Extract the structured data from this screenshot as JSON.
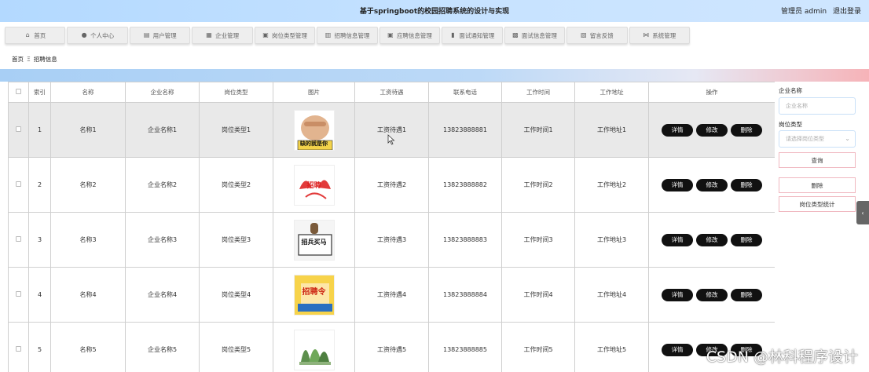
{
  "header": {
    "title": "基于springboot的校园招聘系统的设计与实现",
    "user_label": "管理员 admin",
    "logout_label": "退出登录"
  },
  "nav": [
    {
      "label": "首页",
      "icon": "home-icon"
    },
    {
      "label": "个人中心",
      "icon": "user-icon"
    },
    {
      "label": "用户管理",
      "icon": "bank-icon"
    },
    {
      "label": "企业管理",
      "icon": "grid-icon"
    },
    {
      "label": "岗位类型管理",
      "icon": "apps-icon"
    },
    {
      "label": "招聘信息管理",
      "icon": "chart-icon"
    },
    {
      "label": "应聘信息管理",
      "icon": "apps-icon"
    },
    {
      "label": "面试通知管理",
      "icon": "bar-chart-icon"
    },
    {
      "label": "面试信息管理",
      "icon": "briefcase-icon"
    },
    {
      "label": "留言反馈",
      "icon": "calendar-icon"
    },
    {
      "label": "系统管理",
      "icon": "bowtie-icon"
    }
  ],
  "breadcrumb": {
    "home": "首页",
    "current": "招聘信息"
  },
  "table": {
    "headers": [
      "索引",
      "名称",
      "企业名称",
      "岗位类型",
      "图片",
      "工资待遇",
      "联系电话",
      "工作时间",
      "工作地址",
      "操作"
    ],
    "rows": [
      {
        "index": "1",
        "name": "名称1",
        "company": "企业名称1",
        "type": "岗位类型1",
        "image_caption": "缺的就是你",
        "salary": "工资待遇1",
        "phone": "13823888881",
        "time": "工作时间1",
        "address": "工作地址1"
      },
      {
        "index": "2",
        "name": "名称2",
        "company": "企业名称2",
        "type": "岗位类型2",
        "image_caption": "招聘",
        "salary": "工资待遇2",
        "phone": "13823888882",
        "time": "工作时间2",
        "address": "工作地址2"
      },
      {
        "index": "3",
        "name": "名称3",
        "company": "企业名称3",
        "type": "岗位类型3",
        "image_caption": "招兵买马",
        "salary": "工资待遇3",
        "phone": "13823888883",
        "time": "工作时间3",
        "address": "工作地址3"
      },
      {
        "index": "4",
        "name": "名称4",
        "company": "企业名称4",
        "type": "岗位类型4",
        "image_caption": "招聘令",
        "salary": "工资待遇4",
        "phone": "13823888884",
        "time": "工作时间4",
        "address": "工作地址4"
      },
      {
        "index": "5",
        "name": "名称5",
        "company": "企业名称5",
        "type": "岗位类型5",
        "image_caption": "",
        "salary": "工资待遇5",
        "phone": "13823888885",
        "time": "工作时间5",
        "address": "工作地址5"
      }
    ],
    "actions": {
      "detail": "详情",
      "edit": "修改",
      "delete": "删除"
    }
  },
  "side": {
    "company_label": "企业名称",
    "company_placeholder": "企业名称",
    "type_label": "岗位类型",
    "type_placeholder": "请选择岗位类型",
    "query_button": "查询",
    "delete_button": "删除",
    "stats_button": "岗位类型统计"
  },
  "watermark": "CSDN @林科程序设计"
}
